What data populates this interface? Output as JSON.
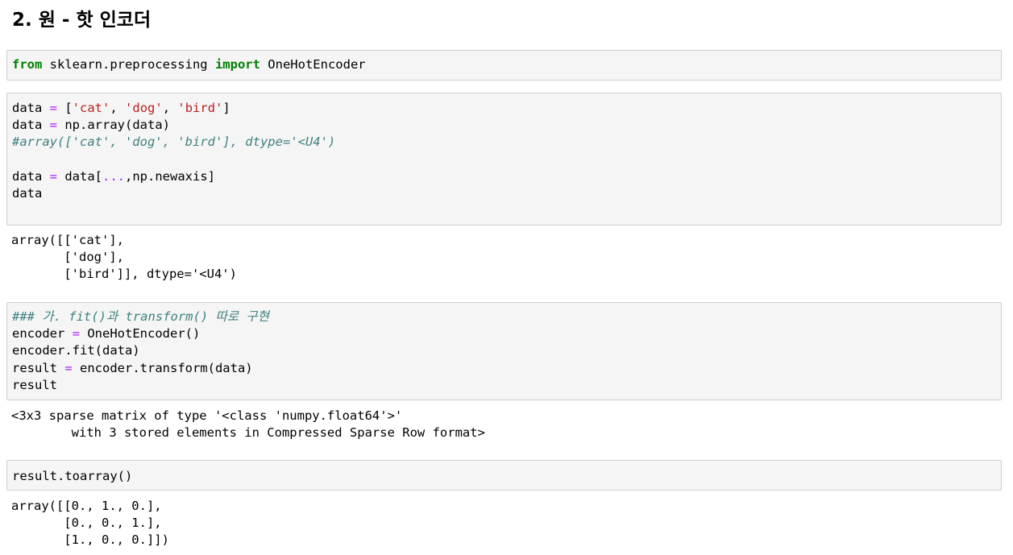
{
  "heading": "2. 원 - 핫 인코더",
  "cells": [
    {
      "type": "input",
      "lines": [
        [
          {
            "t": "from",
            "c": "kw"
          },
          {
            "t": " sklearn.preprocessing ",
            "c": ""
          },
          {
            "t": "import",
            "c": "kw"
          },
          {
            "t": " OneHotEncoder",
            "c": ""
          }
        ]
      ]
    },
    {
      "type": "input",
      "lines": [
        [
          {
            "t": "data ",
            "c": ""
          },
          {
            "t": "=",
            "c": "op"
          },
          {
            "t": " [",
            "c": ""
          },
          {
            "t": "'cat'",
            "c": "str"
          },
          {
            "t": ", ",
            "c": ""
          },
          {
            "t": "'dog'",
            "c": "str"
          },
          {
            "t": ", ",
            "c": ""
          },
          {
            "t": "'bird'",
            "c": "str"
          },
          {
            "t": "]",
            "c": ""
          }
        ],
        [
          {
            "t": "data ",
            "c": ""
          },
          {
            "t": "=",
            "c": "op"
          },
          {
            "t": " np.array(data)",
            "c": ""
          }
        ],
        [
          {
            "t": "#array(['cat', 'dog', 'bird'], dtype='<U4')",
            "c": "com"
          }
        ],
        [
          {
            "t": "",
            "c": ""
          }
        ],
        [
          {
            "t": "data ",
            "c": ""
          },
          {
            "t": "=",
            "c": "op"
          },
          {
            "t": " data[",
            "c": ""
          },
          {
            "t": "...",
            "c": "op"
          },
          {
            "t": ",np.newaxis]",
            "c": ""
          }
        ],
        [
          {
            "t": "data",
            "c": ""
          }
        ],
        [
          {
            "t": "",
            "c": ""
          }
        ]
      ]
    },
    {
      "type": "output",
      "lines": [
        [
          {
            "t": "array([['cat'],",
            "c": ""
          }
        ],
        [
          {
            "t": "       ['dog'],",
            "c": ""
          }
        ],
        [
          {
            "t": "       ['bird']], dtype='<U4')",
            "c": ""
          }
        ]
      ]
    },
    {
      "type": "input",
      "lines": [
        [
          {
            "t": "### 가. fit()과 transform() 따로 구현",
            "c": "com"
          }
        ],
        [
          {
            "t": "encoder ",
            "c": ""
          },
          {
            "t": "=",
            "c": "op"
          },
          {
            "t": " OneHotEncoder()",
            "c": ""
          }
        ],
        [
          {
            "t": "encoder.fit(data)",
            "c": ""
          }
        ],
        [
          {
            "t": "result ",
            "c": ""
          },
          {
            "t": "=",
            "c": "op"
          },
          {
            "t": " encoder.transform(data)",
            "c": ""
          }
        ],
        [
          {
            "t": "result",
            "c": ""
          }
        ]
      ]
    },
    {
      "type": "output",
      "lines": [
        [
          {
            "t": "<3x3 sparse matrix of type '<class 'numpy.float64'>'",
            "c": ""
          }
        ],
        [
          {
            "t": "\twith 3 stored elements in Compressed Sparse Row format>",
            "c": ""
          }
        ]
      ]
    },
    {
      "type": "input",
      "lines": [
        [
          {
            "t": "result.toarray()",
            "c": ""
          }
        ]
      ]
    },
    {
      "type": "output",
      "lines": [
        [
          {
            "t": "array([[0., 1., 0.],",
            "c": ""
          }
        ],
        [
          {
            "t": "       [0., 0., 1.],",
            "c": ""
          }
        ],
        [
          {
            "t": "       [1., 0., 0.]])",
            "c": ""
          }
        ]
      ]
    }
  ]
}
